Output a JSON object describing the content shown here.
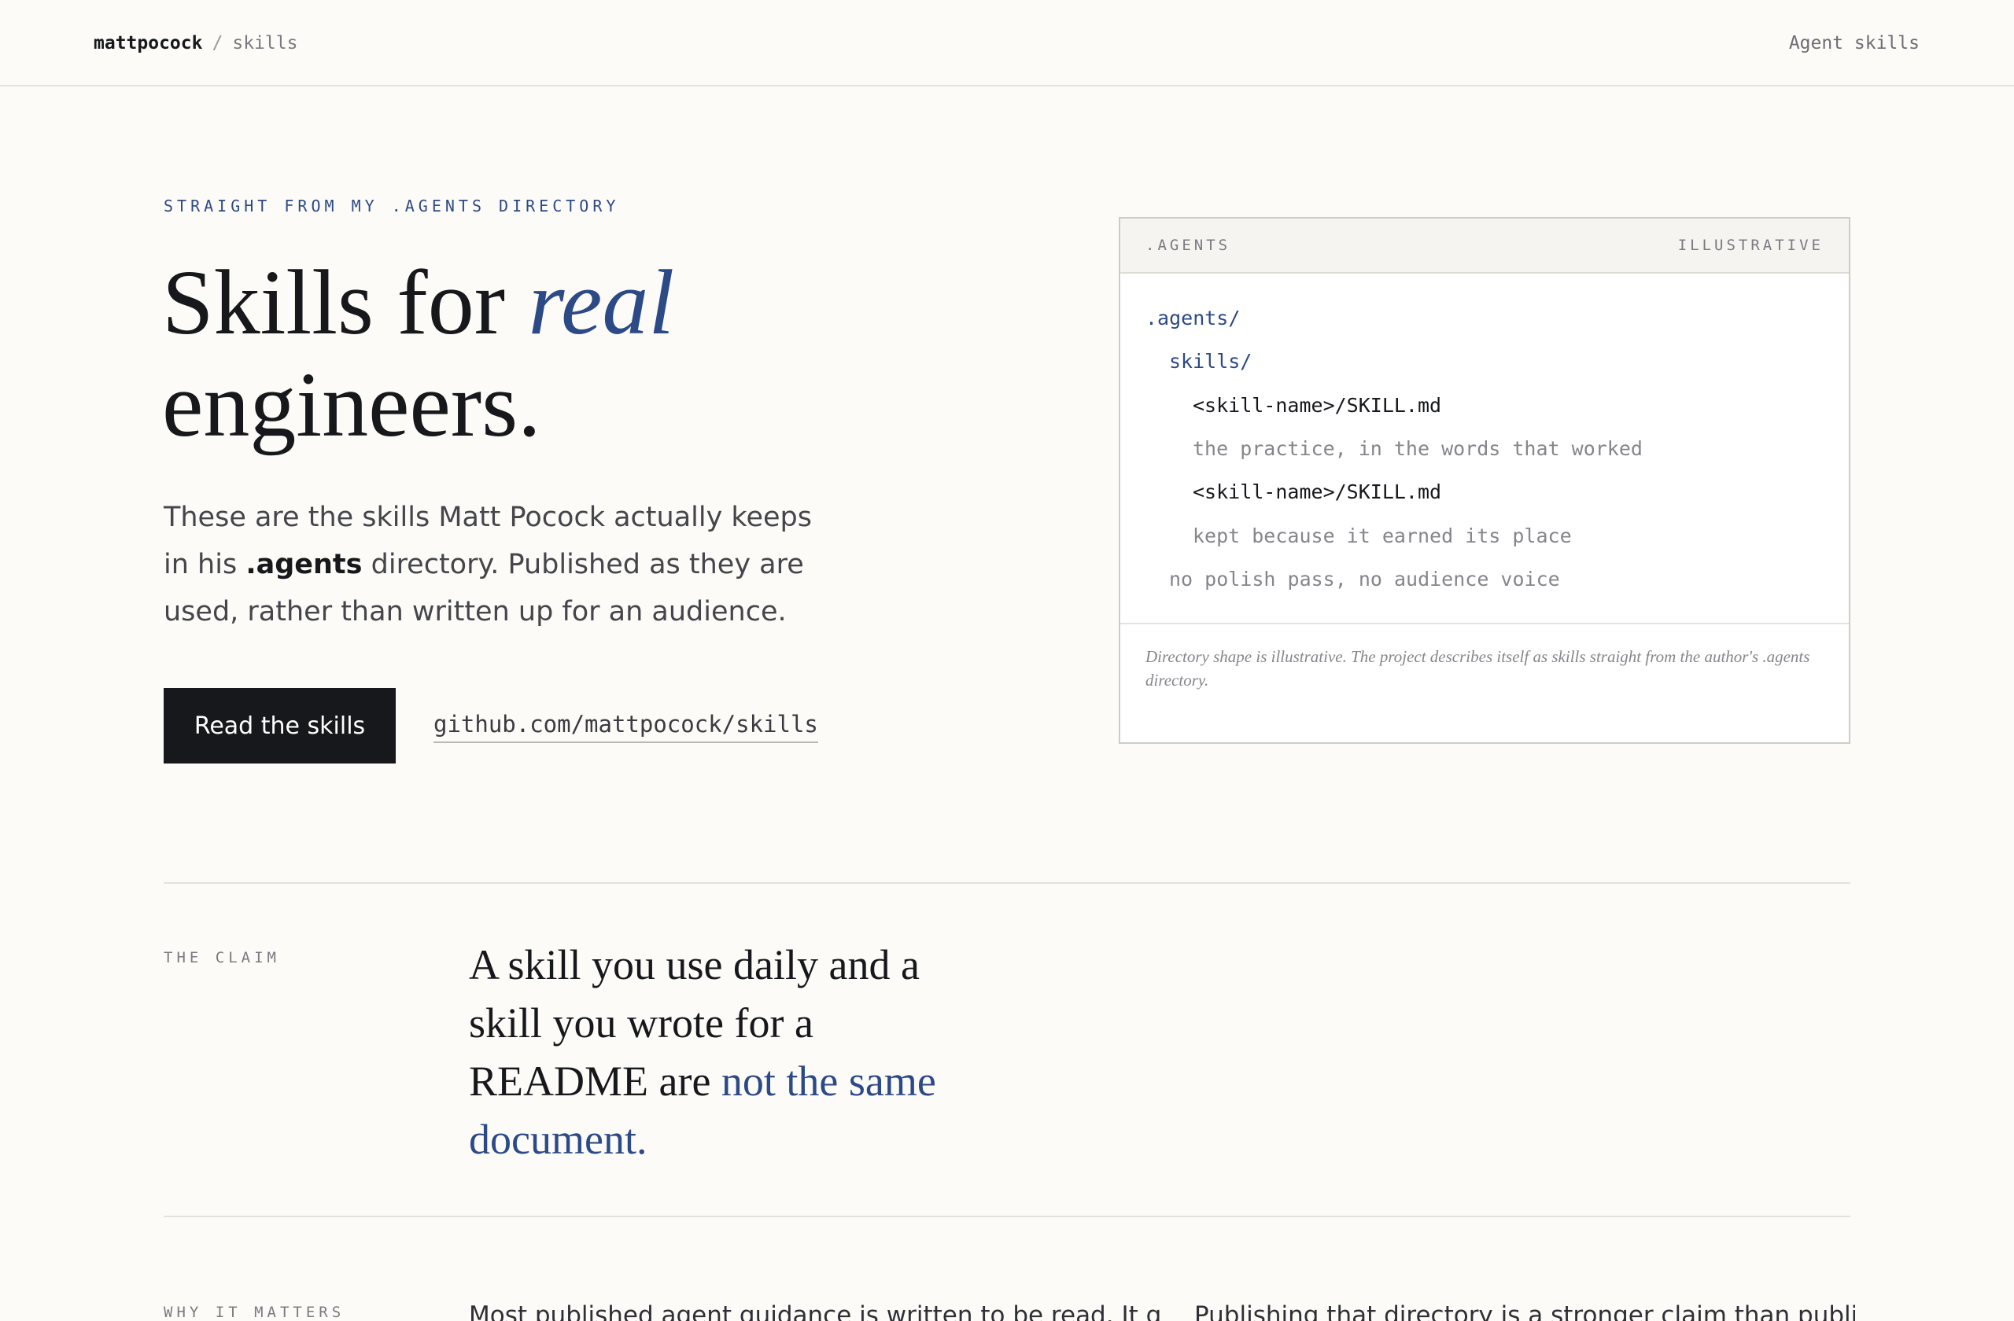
{
  "topbar": {
    "owner": "mattpocock",
    "separator": "/",
    "repo": "skills",
    "nav_link": "Agent skills"
  },
  "hero": {
    "eyebrow": "STRAIGHT FROM MY .AGENTS DIRECTORY",
    "title_part1": "Skills for ",
    "title_em": "real",
    "title_part2": "engineers.",
    "copy_part1": "These are the skills Matt Pocock actually keeps in his ",
    "copy_strong": ".agents",
    "copy_part2": " directory. Published as they are used, rather than written up for an audience.",
    "primary_button": "Read the skills",
    "repo_link": "github.com/mattpocock/skills"
  },
  "card": {
    "title": ".AGENTS",
    "badge": "ILLUSTRATIVE",
    "lines": [
      ".agents/",
      "skills/",
      "<skill-name>/SKILL.md",
      "the practice, in the words that worked",
      "<skill-name>/SKILL.md",
      "kept because it earned its place",
      "no polish pass, no audience voice"
    ],
    "footnote": "Directory shape is illustrative. The project describes itself as skills straight from the author's .agents directory."
  },
  "claim": {
    "label": "THE CLAIM",
    "text_part1": "A skill you use daily and a skill you wrote for a README are ",
    "text_accent": "not the same document."
  },
  "why": {
    "label": "WHY IT MATTERS",
    "col1": "Most published agent guidance is written to be read. It gets",
    "col2": "Publishing that directory is a stronger claim than publishing"
  },
  "colors": {
    "background": "#fcfbf8",
    "ink": "#17181c",
    "accent": "#2c4a86",
    "muted": "#7a7b80",
    "rule": "#e4e2dc"
  }
}
